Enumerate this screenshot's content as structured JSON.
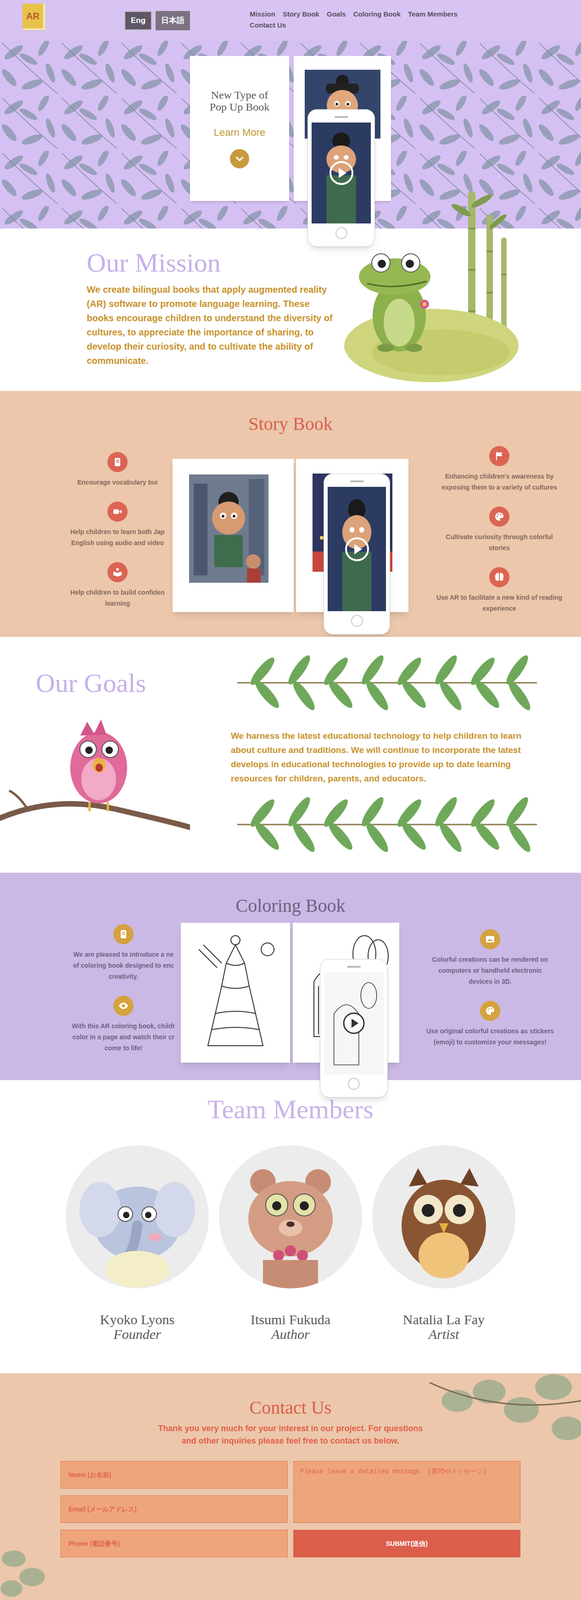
{
  "nav": {
    "logo": "AR",
    "languages": [
      {
        "label": "Eng",
        "selected": true
      },
      {
        "label": "日本語",
        "selected": false
      }
    ],
    "links": [
      "Mission",
      "Story Book",
      "Goals",
      "Coloring Book",
      "Team Members",
      "Contact Us"
    ]
  },
  "hero": {
    "title": "New Type of Pop Up Book",
    "cta": "Learn More"
  },
  "mission": {
    "title": "Our Mission",
    "text": "We create bilingual books that apply augmented reality (AR) software to promote language learning. These books encourage children to understand the diversity of cultures, to appreciate the importance of sharing, to develop their curiosity, and to cultivate the ability of communicate."
  },
  "story_book": {
    "title": "Story Book",
    "left": [
      {
        "lines": [
          "Encourage vocabulary bui"
        ]
      },
      {
        "lines": [
          "Help children to learn both Jap",
          "English using audio and video"
        ]
      },
      {
        "lines": [
          "Help children to build confiden",
          "learning"
        ]
      }
    ],
    "right": [
      {
        "lines": [
          "Enhancing children's awareness by",
          "exposing them to a variety of cultures"
        ]
      },
      {
        "lines": [
          "Cultivate curiosity through colorful",
          "stories"
        ]
      },
      {
        "lines": [
          "Use AR to facilitate a new kind of reading",
          "experience"
        ]
      }
    ]
  },
  "goals": {
    "title": "Our Goals",
    "text": "We harness the latest educational technology to help children to learn about culture and traditions. We will continue to incorporate the latest develops in educational technologies to provide up to date learning resources for children, parents, and educators."
  },
  "coloring_book": {
    "title": "Coloring Book",
    "left": [
      {
        "lines": [
          "We are pleased to introduce a ne",
          "of coloring book designed to enc",
          "creativity."
        ]
      },
      {
        "lines": [
          "With this AR coloring book, childr",
          "color in a page and watch their cr",
          "come to life!"
        ]
      }
    ],
    "right": [
      {
        "lines": [
          "Colorful creations can be rendered on",
          "computers or handheld electronic",
          "devices in 3D."
        ]
      },
      {
        "lines": [
          "Use original colorful creations as stickers",
          "(emoji) to customize your messages!"
        ]
      }
    ]
  },
  "team": {
    "title": "Team Members",
    "members": [
      {
        "name": "Kyoko Lyons",
        "role": "Founder"
      },
      {
        "name": "Itsumi Fukuda",
        "role": "Author"
      },
      {
        "name": "Natalia La Fay",
        "role": "Artist"
      }
    ]
  },
  "contact": {
    "title": "Contact Us",
    "text": "Thank you very much for your interest in our project. For questions and other inquiries please feel free to contact us below.",
    "fields": [
      {
        "placeholder": "Name (お名前)"
      },
      {
        "placeholder": "Email (メールアドレス)"
      },
      {
        "placeholder": "Phone (電話番号)"
      }
    ],
    "message": {
      "placeholder": "Please leave a detailed message. (質問やメッセージ)"
    },
    "submit": "SUBMIT(送信)"
  }
}
